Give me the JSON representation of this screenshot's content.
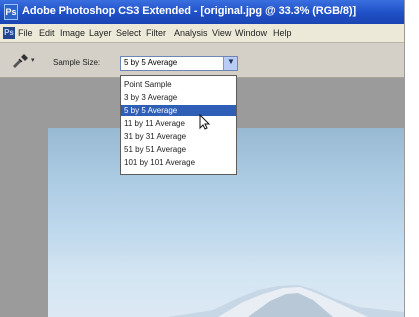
{
  "window": {
    "title": "Adobe Photoshop CS3 Extended - [original.jpg @ 33.3% (RGB/8)]"
  },
  "menu": {
    "items": [
      "File",
      "Edit",
      "Image",
      "Layer",
      "Select",
      "Filter",
      "Analysis",
      "View",
      "Window",
      "Help"
    ]
  },
  "options_bar": {
    "sample_size_label": "Sample Size:",
    "sample_size_value": "5 by 5 Average",
    "tool_icon": "eyedropper-icon"
  },
  "dropdown": {
    "options": [
      "Point Sample",
      "3 by 3 Average",
      "5 by 5 Average",
      "11 by 11 Average",
      "31 by 31 Average",
      "51 by 51 Average",
      "101 by 101 Average"
    ],
    "selected_index": 2
  },
  "colors": {
    "title_bar": "#1f4fc6",
    "selection": "#2f5eb6"
  }
}
